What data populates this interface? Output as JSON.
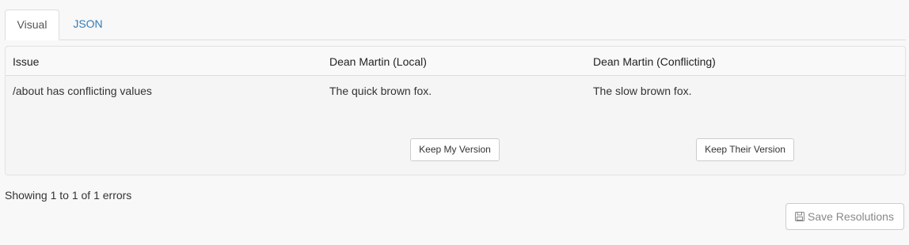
{
  "tabs": [
    {
      "label": "Visual",
      "active": true
    },
    {
      "label": "JSON",
      "active": false
    }
  ],
  "table": {
    "columns": [
      "Issue",
      "Dean Martin (Local)",
      "Dean Martin (Conflicting)"
    ],
    "rows": [
      {
        "issue": "/about has conflicting values",
        "local": "The quick brown fox.",
        "conflicting": "The slow brown fox."
      }
    ],
    "keep_mine_label": "Keep My Version",
    "keep_theirs_label": "Keep Their Version"
  },
  "footer": {
    "info": "Showing 1 to 1 of 1 errors",
    "save_label": "Save Resolutions",
    "save_icon": "floppy-disk-icon"
  },
  "colors": {
    "link": "#337ab7",
    "panel_bg": "#f5f5f5",
    "page_bg": "#f8f8f8"
  }
}
